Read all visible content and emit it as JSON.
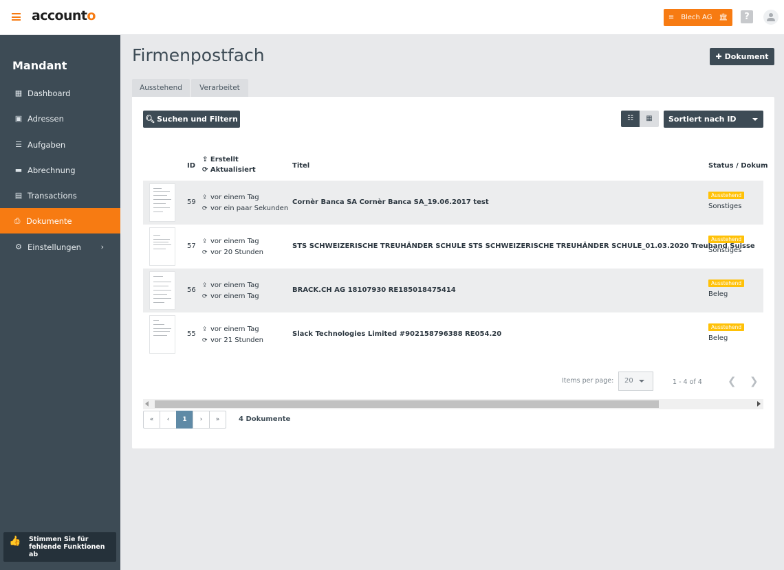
{
  "app": {
    "logo_main": "account",
    "logo_accent": "o"
  },
  "header": {
    "client_label": "Blech AG",
    "client_icon_left": "list-icon",
    "client_icon_right": "bank-icon",
    "help_label": "?"
  },
  "sidebar": {
    "title": "Mandant",
    "items": [
      {
        "label": "Dashboard",
        "icon": "grid-icon"
      },
      {
        "label": "Adressen",
        "icon": "address-book-icon"
      },
      {
        "label": "Aufgaben",
        "icon": "tasks-icon"
      },
      {
        "label": "Abrechnung",
        "icon": "credit-card-icon"
      },
      {
        "label": "Transactions",
        "icon": "file-icon"
      },
      {
        "label": "Dokumente",
        "icon": "printer-icon",
        "active": true
      },
      {
        "label": "Einstellungen",
        "icon": "gear-icon",
        "has_submenu": true
      }
    ],
    "vote_text": "Stimmen Sie für fehlende Funktionen ab"
  },
  "page": {
    "title": "Firmenpostfach",
    "add_button": "Dokument",
    "tabs": [
      {
        "label": "Ausstehend"
      },
      {
        "label": "Verarbeitet"
      }
    ]
  },
  "toolbar": {
    "search_button": "Suchen und Filtern",
    "sort_label": "Sortiert nach ID"
  },
  "table": {
    "headers": {
      "id": "ID",
      "created": "Erstellt",
      "updated": "Aktualisiert",
      "title": "Titel",
      "status": "Status / Dokum"
    },
    "rows": [
      {
        "id": "59",
        "created": "vor einem Tag",
        "updated": "vor ein paar Sekunden",
        "title": "Cornèr Banca SA Cornèr Banca SA_19.06.2017 test",
        "status": "Ausstehend",
        "category": "Sonstiges"
      },
      {
        "id": "57",
        "created": "vor einem Tag",
        "updated": "vor 20 Stunden",
        "title": "STS SCHWEIZERISCHE TREUHÄNDER SCHULE STS SCHWEIZERISCHE TREUHÄNDER SCHULE_01.03.2020 Treuhand Suisse",
        "status": "Ausstehend",
        "category": "Sonstiges"
      },
      {
        "id": "56",
        "created": "vor einem Tag",
        "updated": "vor einem Tag",
        "title": "BRACK.CH AG 18107930 RE185018475414",
        "status": "Ausstehend",
        "category": "Beleg"
      },
      {
        "id": "55",
        "created": "vor einem Tag",
        "updated": "vor 21 Stunden",
        "title": "Slack Technologies Limited #902158796388 RE054.20",
        "status": "Ausstehend",
        "category": "Beleg"
      }
    ]
  },
  "paginator": {
    "items_per_page_label": "Items per page:",
    "items_per_page_value": "20",
    "range_label": "1 - 4 of 4"
  },
  "pagination": {
    "first": "«",
    "prev": "‹",
    "current": "1",
    "next": "›",
    "last": "»",
    "doc_count": "4 Dokumente"
  }
}
